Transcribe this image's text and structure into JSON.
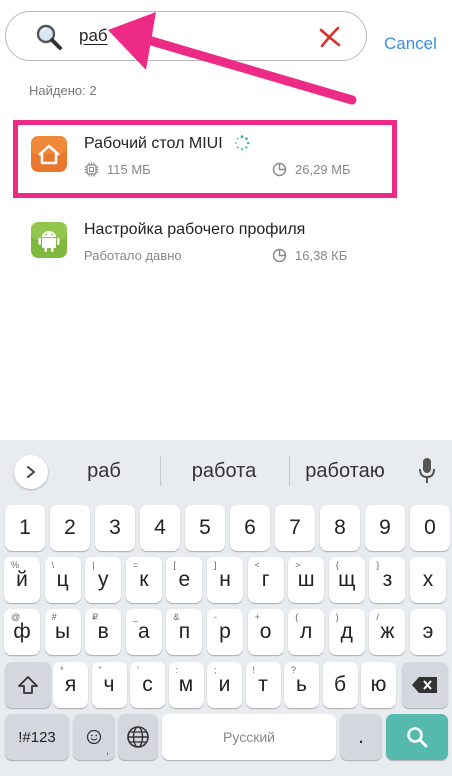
{
  "search": {
    "query": "раб",
    "cancel_label": "Cancel"
  },
  "results": {
    "found_label": "Найдено: 2",
    "apps": [
      {
        "name": "Рабочий стол MIUI",
        "memory": "115 МБ",
        "storage": "26,29 МБ",
        "icon": "home-app-icon"
      },
      {
        "name": "Настройка рабочего профиля",
        "status": "Работало давно",
        "storage": "16,38 КБ",
        "icon": "android-app-icon"
      }
    ]
  },
  "keyboard": {
    "suggestions": [
      "раб",
      "работа",
      "работаю"
    ],
    "number_row": [
      "1",
      "2",
      "3",
      "4",
      "5",
      "6",
      "7",
      "8",
      "9",
      "0"
    ],
    "row1": [
      {
        "k": "й",
        "s": "%"
      },
      {
        "k": "ц",
        "s": "\\"
      },
      {
        "k": "у",
        "s": "|"
      },
      {
        "k": "к",
        "s": "="
      },
      {
        "k": "е",
        "s": "["
      },
      {
        "k": "н",
        "s": "]"
      },
      {
        "k": "г",
        "s": "<"
      },
      {
        "k": "ш",
        "s": ">"
      },
      {
        "k": "щ",
        "s": "{"
      },
      {
        "k": "з",
        "s": "}"
      },
      {
        "k": "х",
        "s": ""
      }
    ],
    "row2": [
      {
        "k": "ф",
        "s": "@"
      },
      {
        "k": "ы",
        "s": "#"
      },
      {
        "k": "в",
        "s": "₽"
      },
      {
        "k": "а",
        "s": "_"
      },
      {
        "k": "п",
        "s": "&"
      },
      {
        "k": "р",
        "s": "-"
      },
      {
        "k": "о",
        "s": "+"
      },
      {
        "k": "л",
        "s": "("
      },
      {
        "k": "д",
        "s": ")"
      },
      {
        "k": "ж",
        "s": "/"
      },
      {
        "k": "э",
        "s": ""
      }
    ],
    "row3": [
      {
        "k": "я",
        "s": "*"
      },
      {
        "k": "ч",
        "s": "\""
      },
      {
        "k": "с",
        "s": "'"
      },
      {
        "k": "м",
        "s": ":"
      },
      {
        "k": "и",
        "s": ";"
      },
      {
        "k": "т",
        "s": "!"
      },
      {
        "k": "ь",
        "s": "?"
      },
      {
        "k": "б",
        "s": ""
      },
      {
        "k": "ю",
        "s": ""
      }
    ],
    "symbols_label": "!#123",
    "space_label": "Русский",
    "period_label": ".",
    "accent_color": "#55b9ad",
    "highlight_color": "#ee2a87"
  }
}
